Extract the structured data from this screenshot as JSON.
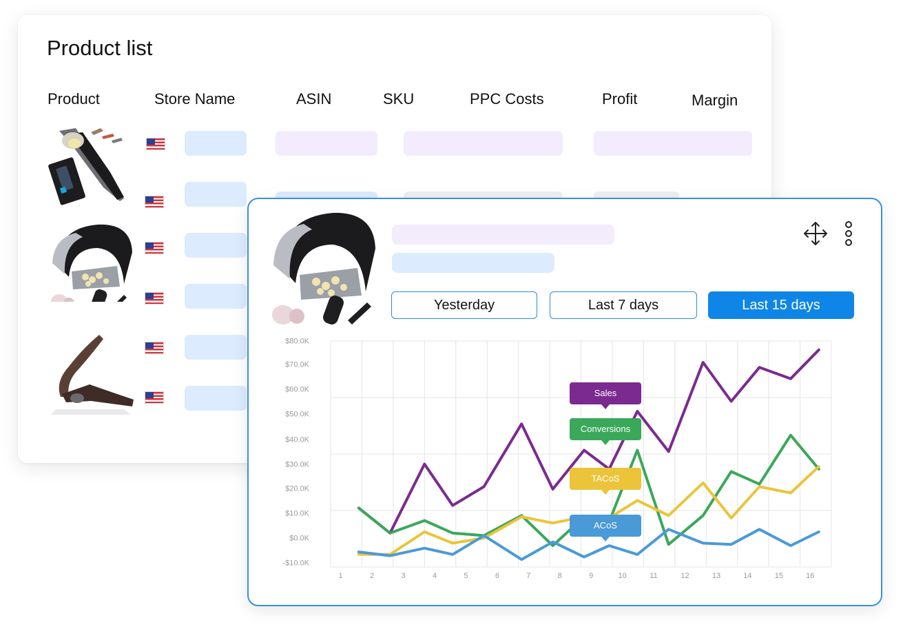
{
  "product_list": {
    "title": "Product list",
    "columns": [
      "Product",
      "Store Name",
      "ASIN",
      "SKU",
      "PPC Costs",
      "Profit",
      "Margin"
    ]
  },
  "chart_data": {
    "type": "line",
    "x": [
      1,
      2,
      3,
      4,
      5,
      6,
      7,
      8,
      9,
      10,
      11,
      12,
      13,
      14,
      15,
      16
    ],
    "y_ticks": [
      "$80.0K",
      "$70.0K",
      "$60.0K",
      "$50.0K",
      "$40.0K",
      "$30.0K",
      "$20.0K",
      "$10.0K",
      "$0.0K",
      "-$10.0K"
    ],
    "ylim": [
      -10,
      80
    ],
    "grid": true,
    "series": [
      {
        "name": "Sales",
        "color": "#7b2a8f",
        "points": [
          [
            1.4,
            13.5
          ],
          [
            2.4,
            3.5
          ],
          [
            3.5,
            31
          ],
          [
            4.4,
            14.5
          ],
          [
            5.4,
            22
          ],
          [
            6.6,
            47
          ],
          [
            7.6,
            21
          ],
          [
            8.6,
            36.5
          ],
          [
            9.4,
            29
          ],
          [
            10.3,
            52
          ],
          [
            11.3,
            36
          ],
          [
            12.4,
            71.5
          ],
          [
            13.3,
            56
          ],
          [
            14.2,
            69.5
          ],
          [
            15.2,
            65
          ],
          [
            16.1,
            76.5
          ]
        ]
      },
      {
        "name": "Conversions",
        "color": "#3aa85a",
        "points": [
          [
            1.4,
            13.5
          ],
          [
            2.4,
            3.5
          ],
          [
            3.5,
            8.5
          ],
          [
            4.4,
            3.5
          ],
          [
            5.4,
            2.5
          ],
          [
            6.6,
            10.5
          ],
          [
            7.6,
            -1.5
          ],
          [
            8.6,
            10
          ],
          [
            9.4,
            8
          ],
          [
            10.3,
            36.5
          ],
          [
            11.3,
            -1
          ],
          [
            12.4,
            10.5
          ],
          [
            13.3,
            28
          ],
          [
            14.2,
            23
          ],
          [
            15.2,
            42.5
          ],
          [
            16.1,
            29
          ]
        ]
      },
      {
        "name": "TACoS",
        "color": "#ebc43a",
        "points": [
          [
            1.4,
            -5
          ],
          [
            2.4,
            -5
          ],
          [
            3.5,
            4
          ],
          [
            4.4,
            -0.5
          ],
          [
            5.4,
            1.5
          ],
          [
            6.6,
            10
          ],
          [
            7.6,
            7.5
          ],
          [
            8.6,
            10
          ],
          [
            9.4,
            9.5
          ],
          [
            10.3,
            16.5
          ],
          [
            11.3,
            10.5
          ],
          [
            12.4,
            23.5
          ],
          [
            13.3,
            9.5
          ],
          [
            14.2,
            22
          ],
          [
            15.2,
            19.5
          ],
          [
            16.1,
            30
          ]
        ]
      },
      {
        "name": "ACoS",
        "color": "#4a9ad8",
        "points": [
          [
            1.4,
            -4
          ],
          [
            2.4,
            -5.5
          ],
          [
            3.5,
            -2.5
          ],
          [
            4.4,
            -5
          ],
          [
            5.4,
            2.5
          ],
          [
            6.6,
            -7
          ],
          [
            7.6,
            0
          ],
          [
            8.6,
            -6
          ],
          [
            9.4,
            -1.5
          ],
          [
            10.3,
            -5
          ],
          [
            11.3,
            5
          ],
          [
            12.4,
            -0.5
          ],
          [
            13.3,
            -1
          ],
          [
            14.2,
            5
          ],
          [
            15.2,
            -1.5
          ],
          [
            16.1,
            4
          ]
        ]
      }
    ]
  },
  "detail": {
    "buttons": {
      "yesterday": "Yesterday",
      "last7": "Last 7 days",
      "last15": "Last 15 days"
    },
    "active_range": "Last 15 days"
  },
  "icons": {
    "move": "move-arrows-icon",
    "menu": "vertical-dots-icon",
    "flag": "us-flag-icon"
  },
  "colors": {
    "accent": "#0f86e7",
    "card_border": "#3b8fe0",
    "pill_blue": "#dcebfd",
    "pill_violet": "#f3ecfc"
  }
}
